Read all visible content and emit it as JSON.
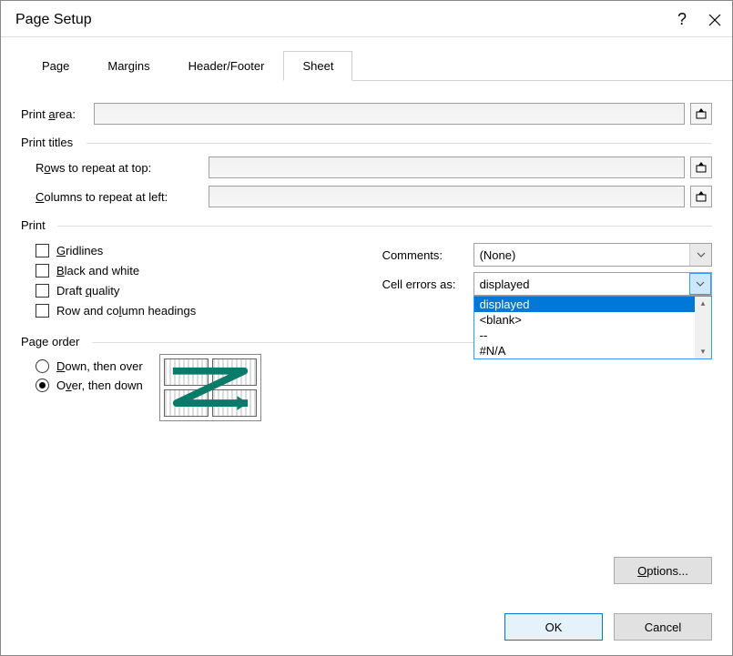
{
  "title": "Page Setup",
  "tabs": [
    "Page",
    "Margins",
    "Header/Footer",
    "Sheet"
  ],
  "active_tab": "Sheet",
  "print_area_label": "Print area:",
  "print_area_value": "",
  "groups": {
    "print_titles": "Print titles",
    "print": "Print",
    "page_order": "Page order"
  },
  "rows_label_pre": "R",
  "rows_label_ul": "o",
  "rows_label_post": "ws to repeat at top:",
  "cols_label_ul": "C",
  "cols_label_post": "olumns to repeat at left:",
  "rows_value": "",
  "cols_value": "",
  "checks": {
    "gridlines_ul": "G",
    "gridlines_post": "ridlines",
    "bw_ul": "B",
    "bw_post": "lack and white",
    "draft_pre": "Draft ",
    "draft_ul": "q",
    "draft_post": "uality",
    "headings_pre": "Row and co",
    "headings_ul": "l",
    "headings_post": "umn headings"
  },
  "comments_label": "Comments:",
  "comments_value": "(None)",
  "errors_label": "Cell errors as:",
  "errors_value": "displayed",
  "errors_options": [
    "displayed",
    "<blank>",
    "--",
    "#N/A"
  ],
  "radio_down_ul": "D",
  "radio_down_post": "own, then over",
  "radio_over_pre": "O",
  "radio_over_ul": "v",
  "radio_over_post": "er, then down",
  "radio_selected": "over",
  "options_btn_pre": "",
  "options_btn_ul": "O",
  "options_btn_post": "ptions...",
  "ok": "OK",
  "cancel": "Cancel"
}
